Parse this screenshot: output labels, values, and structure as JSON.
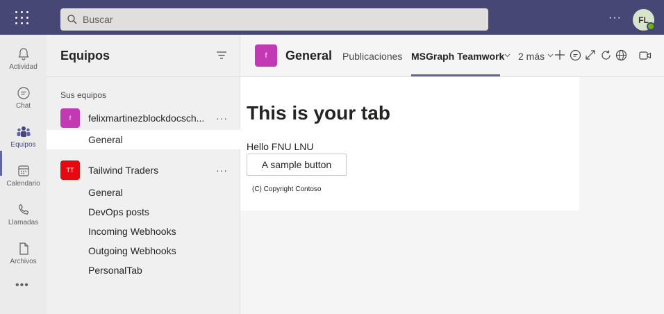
{
  "search": {
    "placeholder": "Buscar"
  },
  "user": {
    "initials": "FL"
  },
  "rail": {
    "items": [
      {
        "label": "Actividad",
        "icon": "bell-icon"
      },
      {
        "label": "Chat",
        "icon": "chat-icon"
      },
      {
        "label": "Equipos",
        "icon": "teams-icon"
      },
      {
        "label": "Calendario",
        "icon": "calendar-icon"
      },
      {
        "label": "Llamadas",
        "icon": "phone-icon"
      },
      {
        "label": "Archivos",
        "icon": "file-icon"
      }
    ],
    "more": "•••"
  },
  "panel": {
    "title": "Equipos",
    "section_label": "Sus equipos",
    "teams": [
      {
        "name": "felixmartinezblockdocsch...",
        "avatar_text": "f",
        "avatar_color": "#c239b3",
        "more": "···",
        "channels": [
          "General"
        ]
      },
      {
        "name": "Tailwind Traders",
        "avatar_text": "TT",
        "avatar_color": "#e8080f",
        "more": "···",
        "channels": [
          "General",
          "DevOps posts",
          "Incoming Webhooks",
          "Outgoing Webhooks",
          "PersonalTab"
        ]
      }
    ]
  },
  "main": {
    "channel_avatar": "f",
    "channel_title": "General",
    "tabs": [
      "Publicaciones",
      "MSGraph Teamwork",
      "2 más"
    ],
    "active_tab": "MSGraph Teamwork",
    "content": {
      "heading": "This is your tab",
      "hello": "Hello FNU LNU",
      "button": "A sample button",
      "copyright": "(C) Copyright Contoso"
    }
  },
  "colors": {
    "topbar": "#464775",
    "accent": "#6264a7",
    "presence": "#6bb700"
  }
}
